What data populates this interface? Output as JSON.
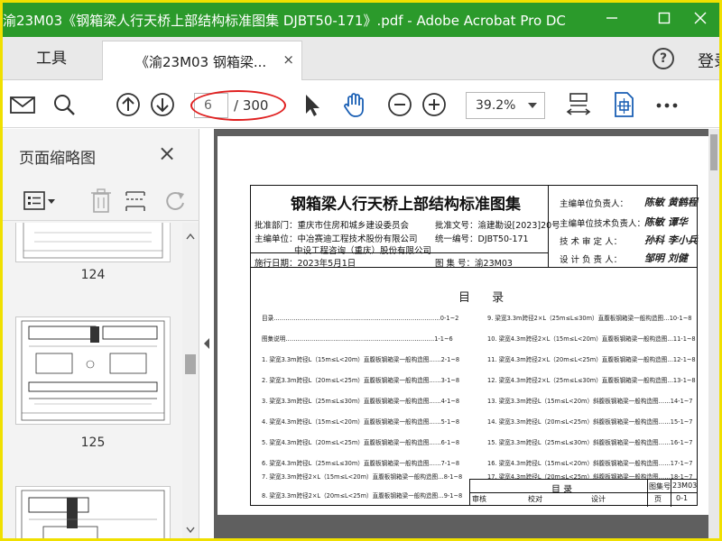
{
  "window": {
    "title": "渝23M03《钢箱梁人行天桥上部结构标准图集 DJBT50-171》.pdf - Adobe Acrobat Pro DC",
    "accent_color": "#2b9a2b"
  },
  "tabs": {
    "tools_label": "工具",
    "doc_tab_label": "《渝23M03 钢箱梁...",
    "close_glyph": "×",
    "help_glyph": "?",
    "login_label": "登录"
  },
  "toolbar": {
    "page_current": "6",
    "page_total": "/ 300",
    "zoom": "39.2%"
  },
  "panel": {
    "title": "页面缩略图",
    "thumbnails": [
      {
        "label": "124"
      },
      {
        "label": "125"
      }
    ]
  },
  "document": {
    "heading": "钢箱梁人行天桥上部结构标准图集",
    "approving_dept": "批准部门：重庆市住房和城乡建设委员会",
    "editor_unit_1": "主编单位：中冶赛迪工程技术股份有限公司",
    "editor_unit_2": "中设工程咨询（重庆）股份有限公司",
    "effective_date": "施行日期：2023年5月1日",
    "approval_doc": "批准文号：渝建勘设[2023]20号",
    "unified_no": "统一编号：DJBT50-171",
    "atlas_no": "图 集 号：渝23M03",
    "roles": [
      {
        "role": "主编单位负责人：",
        "sig": "陈敏 黄鹤程"
      },
      {
        "role": "主编单位技术负责人：",
        "sig": "陈敏 谭华"
      },
      {
        "role": "技 术 审 定 人：",
        "sig": "孙科 李小兵"
      },
      {
        "role": "设 计 负 责 人：",
        "sig": "邹明 刘健"
      }
    ],
    "toc_heading": "目 录",
    "toc_left": [
      "目录…………………………………………………………………………0-1~2",
      "图集说明…………………………………………………………………1-1~6",
      "1. 梁宽3.3m跨径L（15m≤L<20m）直腹板钢箱梁一般构造图……2-1~8",
      "2. 梁宽3.3m跨径L（20m≤L<25m）直腹板钢箱梁一般构造图……3-1~8",
      "3. 梁宽3.3m跨径L（25m≤L≤30m）直腹板钢箱梁一般构造图……4-1~8",
      "4. 梁宽4.3m跨径L（15m≤L<20m）直腹板钢箱梁一般构造图……5-1~8",
      "5. 梁宽4.3m跨径L（20m≤L<25m）直腹板钢箱梁一般构造图……6-1~8",
      "6. 梁宽4.3m跨径L（25m≤L≤30m）直腹板钢箱梁一般构造图……7-1~8",
      "7. 梁宽3.3m跨径2×L（15m≤L<20m）直腹板钢箱梁一般构造图…8-1~8",
      "8. 梁宽3.3m跨径2×L（20m≤L<25m）直腹板钢箱梁一般构造图…9-1~8"
    ],
    "toc_right": [
      "9. 梁宽3.3m跨径2×L（25m≤L≤30m）直腹板钢箱梁一般构造图…10-1~8",
      "10. 梁宽4.3m跨径2×L（15m≤L<20m）直腹板钢箱梁一般构造图…11-1~8",
      "11. 梁宽4.3m跨径2×L（20m≤L<25m）直腹板钢箱梁一般构造图…12-1~8",
      "12. 梁宽4.3m跨径2×L（25m≤L≤30m）直腹板钢箱梁一般构造图…13-1~8",
      "13. 梁宽3.3m跨径L（15m≤L<20m）斜腹板钢箱梁一般构造图……14-1~7",
      "14. 梁宽3.3m跨径L（20m≤L<25m）斜腹板钢箱梁一般构造图……15-1~7",
      "15. 梁宽3.3m跨径L（25m≤L≤30m）斜腹板钢箱梁一般构造图……16-1~7",
      "16. 梁宽4.3m跨径L（15m≤L<20m）斜腹板钢箱梁一般构造图……17-1~7",
      "17. 梁宽4.3m跨径L（20m≤L<25m）斜腹板钢箱梁一般构造图……18-1~7"
    ],
    "title_block": {
      "name": "目 录",
      "atlas_label": "图集号",
      "atlas_value": "23M03",
      "review": "审核",
      "check": "校对",
      "design": "设计",
      "page_label": "页",
      "page_value": "0-1"
    }
  }
}
